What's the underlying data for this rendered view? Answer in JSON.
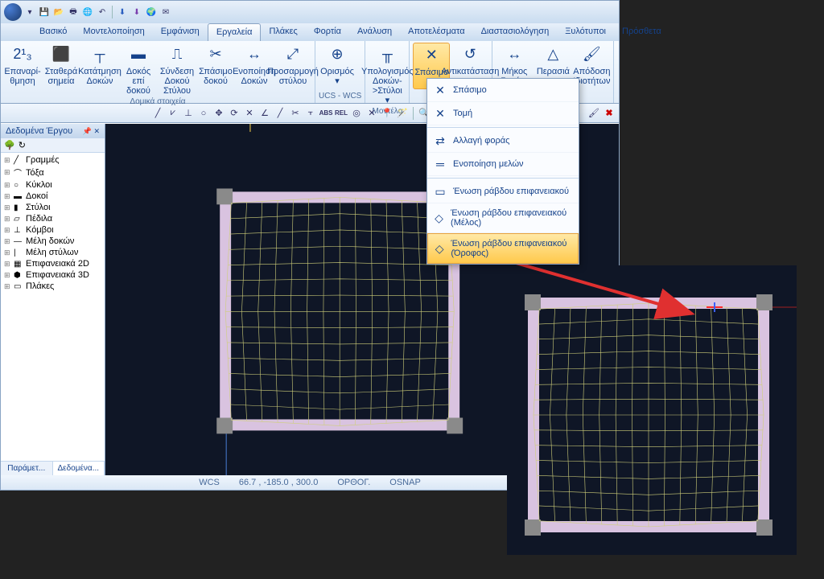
{
  "tabs": [
    "Βασικό",
    "Μοντελοποίηση",
    "Εμφάνιση",
    "Εργαλεία",
    "Πλάκες",
    "Φορτία",
    "Ανάλυση",
    "Αποτελέσματα",
    "Διαστασιολόγηση",
    "Ξυλότυποι",
    "Πρόσθετα"
  ],
  "active_tab": 3,
  "ribbon_groups": [
    {
      "label": "Δομικά στοιχεία",
      "buttons": [
        {
          "name": "renumber",
          "label": "Επαναρί-\nθμηση",
          "icon": "2¹₃"
        },
        {
          "name": "fixed-points",
          "label": "Σταθερά\nσημεία",
          "icon": "⬛"
        },
        {
          "name": "beam-split",
          "label": "Κατάτμηση\nΔοκών",
          "icon": "┬"
        },
        {
          "name": "beam-on-beam",
          "label": "Δοκός επί\nδοκού",
          "icon": "▬"
        },
        {
          "name": "column-beam-conn",
          "label": "Σύνδεση Δοκού\nΣτύλου",
          "icon": "⎍"
        },
        {
          "name": "beam-break",
          "label": "Σπάσιμο\nδοκού",
          "icon": "✂"
        },
        {
          "name": "beam-unify",
          "label": "Ενοποίηση\nΔοκών",
          "icon": "↔"
        },
        {
          "name": "column-adapt",
          "label": "Προσαρμογή\nστύλου",
          "icon": "⤢"
        }
      ]
    },
    {
      "label": "UCS - WCS",
      "buttons": [
        {
          "name": "ucs-define",
          "label": "Ορισμός\n▾",
          "icon": "⊕"
        }
      ]
    },
    {
      "label": "Μοντέλο",
      "buttons": [
        {
          "name": "calc-beams-cols",
          "label": "Υπολογισμός Δοκών->Στύλοι\n▾",
          "icon": "╥"
        }
      ]
    },
    {
      "label": "",
      "buttons": [
        {
          "name": "break-menu",
          "label": "Σπάσιμο\n▾",
          "icon": "✕",
          "active": true
        },
        {
          "name": "restore",
          "label": "Αντικατάσταση",
          "icon": "↺"
        }
      ]
    },
    {
      "label": "",
      "buttons": [
        {
          "name": "length-angle",
          "label": "Μήκος\nΓωνία▾",
          "icon": "↔"
        },
        {
          "name": "trim",
          "label": "Περασιά",
          "icon": "△"
        },
        {
          "name": "assign-props",
          "label": "Απόδοση\nΙδιοτήτων",
          "icon": "🖌"
        }
      ]
    }
  ],
  "dropdown": [
    {
      "name": "dd-break",
      "label": "Σπάσιμο",
      "icon": "✕"
    },
    {
      "name": "dd-cut",
      "label": "Τομή",
      "icon": "✕"
    },
    {
      "name": "dd-reverse",
      "label": "Αλλαγή φοράς",
      "icon": "⇄"
    },
    {
      "name": "dd-unify-members",
      "label": "Ενοποίηση μελών",
      "icon": "═"
    },
    {
      "name": "dd-join-surface",
      "label": "Ένωση ράβδου επιφανειακού",
      "icon": "▭"
    },
    {
      "name": "dd-join-surface-member",
      "label": "Ένωση ράβδου επιφανειακού (Μέλος)",
      "icon": "◇"
    },
    {
      "name": "dd-join-surface-floor",
      "label": "Ένωση ράβδου επιφανειακού (Όροφος)",
      "icon": "◇",
      "hl": true
    }
  ],
  "sidebar": {
    "title": "Δεδομένα Έργου",
    "tree": [
      {
        "label": "Γραμμές",
        "icon": "╱"
      },
      {
        "label": "Τόξα",
        "icon": "⌒"
      },
      {
        "label": "Κύκλοι",
        "icon": "○"
      },
      {
        "label": "Δοκοί",
        "icon": "▬"
      },
      {
        "label": "Στύλοι",
        "icon": "▮"
      },
      {
        "label": "Πέδιλα",
        "icon": "▱"
      },
      {
        "label": "Κόμβοι",
        "icon": "⊥"
      },
      {
        "label": "Μέλη δοκών",
        "icon": "—"
      },
      {
        "label": "Μέλη στύλων",
        "icon": "|"
      },
      {
        "label": "Επιφανειακά 2D",
        "icon": "▦"
      },
      {
        "label": "Επιφανειακά 3D",
        "icon": "⬢"
      },
      {
        "label": "Πλάκες",
        "icon": "▭"
      }
    ],
    "bottom_tabs": [
      "Παράμετ...",
      "Δεδομένα..."
    ]
  },
  "status": {
    "wcs": "WCS",
    "coords": "66.7 , -185.0 , 300.0",
    "ortho": "ΟΡΘΟΓ.",
    "osnap": "OSNAP"
  }
}
